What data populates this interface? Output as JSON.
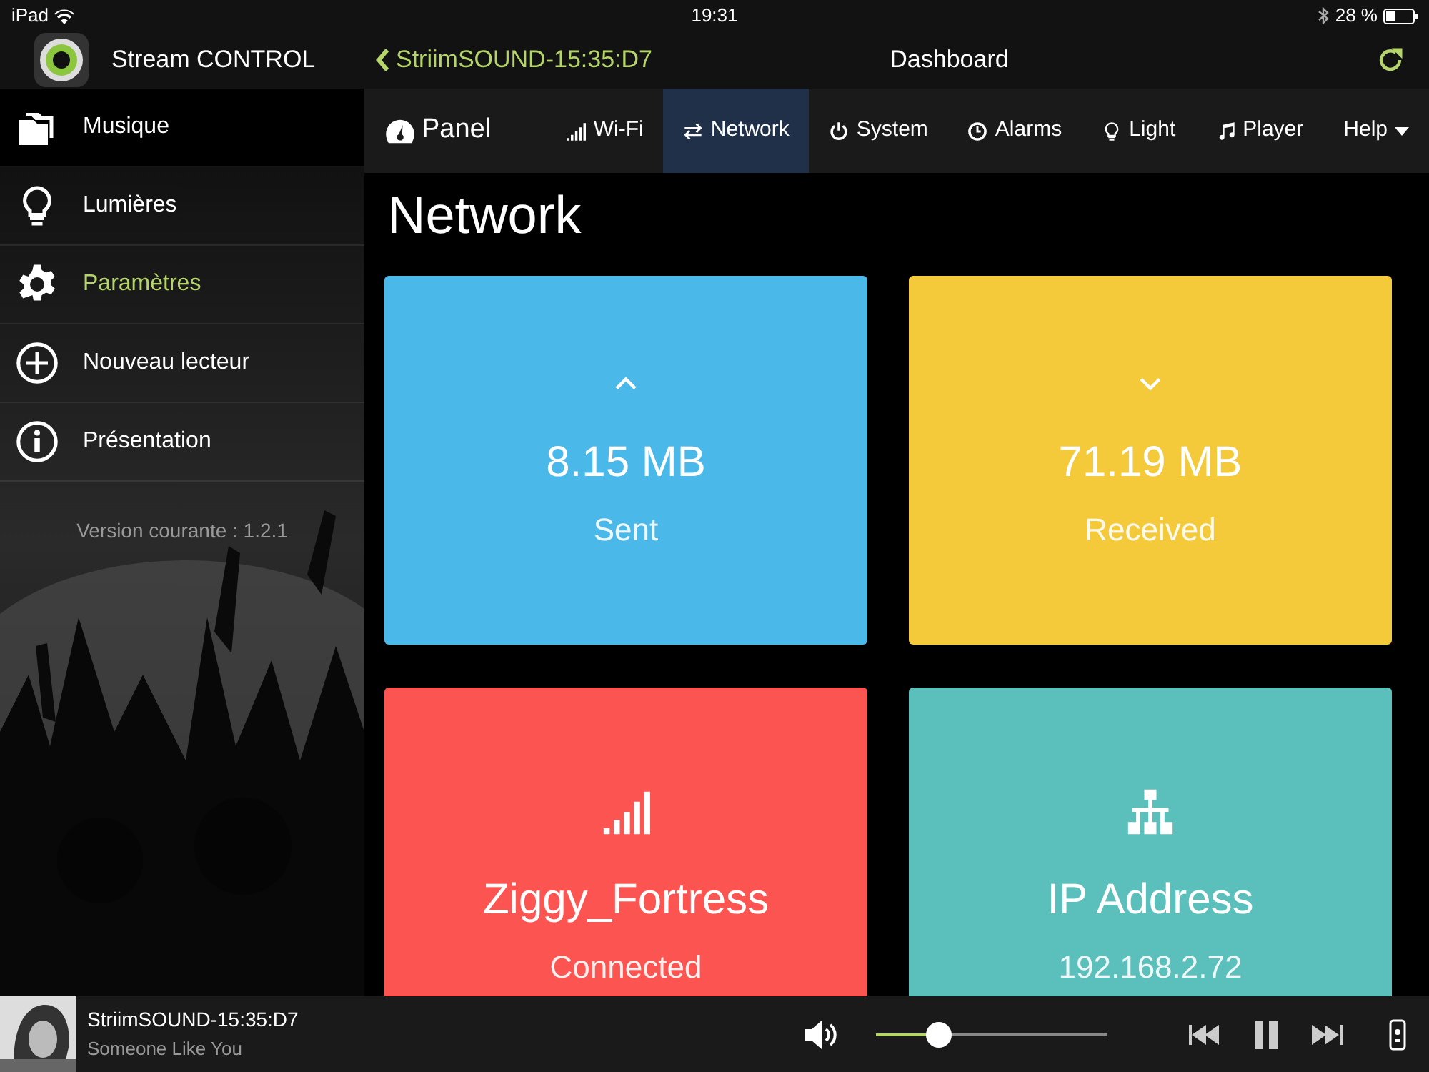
{
  "status_bar": {
    "device": "iPad",
    "time": "19:31",
    "battery": "28 %"
  },
  "app_header": {
    "title": "Stream CONTROL",
    "back": "StriimSOUND-15:35:D7",
    "page_title": "Dashboard"
  },
  "sidebar": {
    "items": [
      {
        "label": "Musique",
        "selected": false
      },
      {
        "label": "Lumières",
        "selected": false
      },
      {
        "label": "Paramètres",
        "selected": true
      },
      {
        "label": "Nouveau lecteur",
        "selected": false
      },
      {
        "label": "Présentation",
        "selected": false
      }
    ],
    "version": "Version courante : 1.2.1"
  },
  "nav": {
    "brand": "Panel",
    "tabs": [
      {
        "label": "Wi-Fi",
        "selected": false,
        "dropdown": false
      },
      {
        "label": "Network",
        "selected": true,
        "dropdown": false
      },
      {
        "label": "System",
        "selected": false,
        "dropdown": false
      },
      {
        "label": "Alarms",
        "selected": false,
        "dropdown": false
      },
      {
        "label": "Light",
        "selected": false,
        "dropdown": false
      },
      {
        "label": "Player",
        "selected": false,
        "dropdown": false
      },
      {
        "label": "Help",
        "selected": false,
        "dropdown": true
      }
    ]
  },
  "heading": "Network",
  "cards": [
    {
      "value": "8.15 MB",
      "caption": "Sent",
      "color": "#4ab9ea"
    },
    {
      "value": "71.19 MB",
      "caption": "Received",
      "color": "#f4c93a"
    },
    {
      "value": "Ziggy_Fortress",
      "caption": "Connected",
      "color": "#fc5450"
    },
    {
      "value": "IP Address",
      "caption": "192.168.2.72",
      "color": "#5bbfbc"
    }
  ],
  "player": {
    "device": "StriimSOUND-15:35:D7",
    "track": "Someone Like You",
    "level": 0.27
  }
}
